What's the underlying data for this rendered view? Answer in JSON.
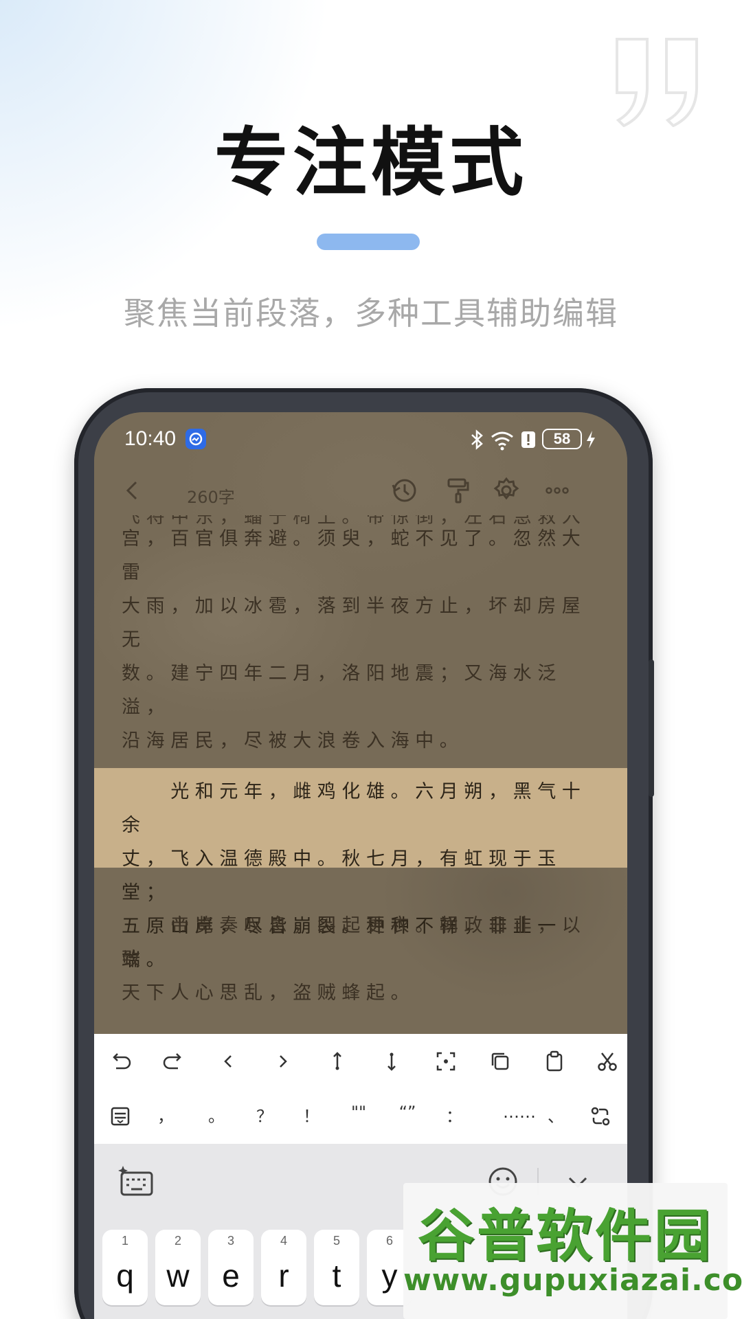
{
  "promo": {
    "headline": "专注模式",
    "subtitle": "聚焦当前段落，多种工具辅助编辑",
    "accent_color": "#8db8ef"
  },
  "statusbar": {
    "time": "10:40",
    "battery": "58",
    "icons": [
      "app-notification-icon",
      "bluetooth-icon",
      "wifi-icon",
      "alert-icon",
      "battery-icon",
      "charging-icon"
    ]
  },
  "editor": {
    "word_count": "260字",
    "toolbar_icons": [
      "back-icon",
      "history-icon",
      "paint-roller-icon",
      "settings-icon",
      "more-icon"
    ],
    "partial_line_top": "飞将中东，蟠于椅上。帝惊倒，左右急救入",
    "paragraphs": [
      {
        "lines": [
          "宫，百官俱奔避。须臾，蛇不见了。忽然大雷",
          "大雨，加以冰雹，落到半夜方止，坏却房屋无",
          "数。"
        ]
      },
      {
        "lines": [
          "　　建宁四年二月，洛阳地震；又海水泛溢，",
          "沿海居民，尽被大浪卷入海中。"
        ]
      },
      {
        "lines": [
          "　　光和元年，雌鸡化雄。六月朔，黑气十余",
          "丈，飞入温德殿中。秋七月，有虹现于玉堂；",
          "五原山岸，尽皆崩裂。种种不祥，非止一端。"
        ],
        "focused": true
      },
      {
        "lines": [
          "　　帝览奏叹息，因起更衣。朝政日非，以致",
          "天下人心思乱，盗贼蜂起。"
        ]
      }
    ],
    "paper_color": "#776b57",
    "highlight_color": "#c8b08a"
  },
  "edit_tools": [
    "undo-icon",
    "redo-icon",
    "cursor-left-icon",
    "cursor-right-icon",
    "select-up-icon",
    "select-down-icon",
    "select-all-icon",
    "copy-icon",
    "paste-icon",
    "cut-icon"
  ],
  "punctuation": {
    "items": [
      "，",
      "。",
      "？",
      "！",
      "\"\"",
      "“”",
      "：",
      "……",
      "、"
    ],
    "icons": [
      "format-icon",
      "convert-icon"
    ]
  },
  "keyboard": {
    "keys": [
      {
        "num": "1",
        "letter": "q"
      },
      {
        "num": "2",
        "letter": "w"
      },
      {
        "num": "3",
        "letter": "e"
      },
      {
        "num": "4",
        "letter": "r"
      },
      {
        "num": "5",
        "letter": "t"
      },
      {
        "num": "6",
        "letter": "y"
      }
    ],
    "top_icons": [
      "ai-keyboard-icon",
      "emoji-icon",
      "collapse-icon"
    ]
  },
  "watermark": {
    "title": "谷普软件园",
    "url": "www.gupuxiazai.com"
  }
}
